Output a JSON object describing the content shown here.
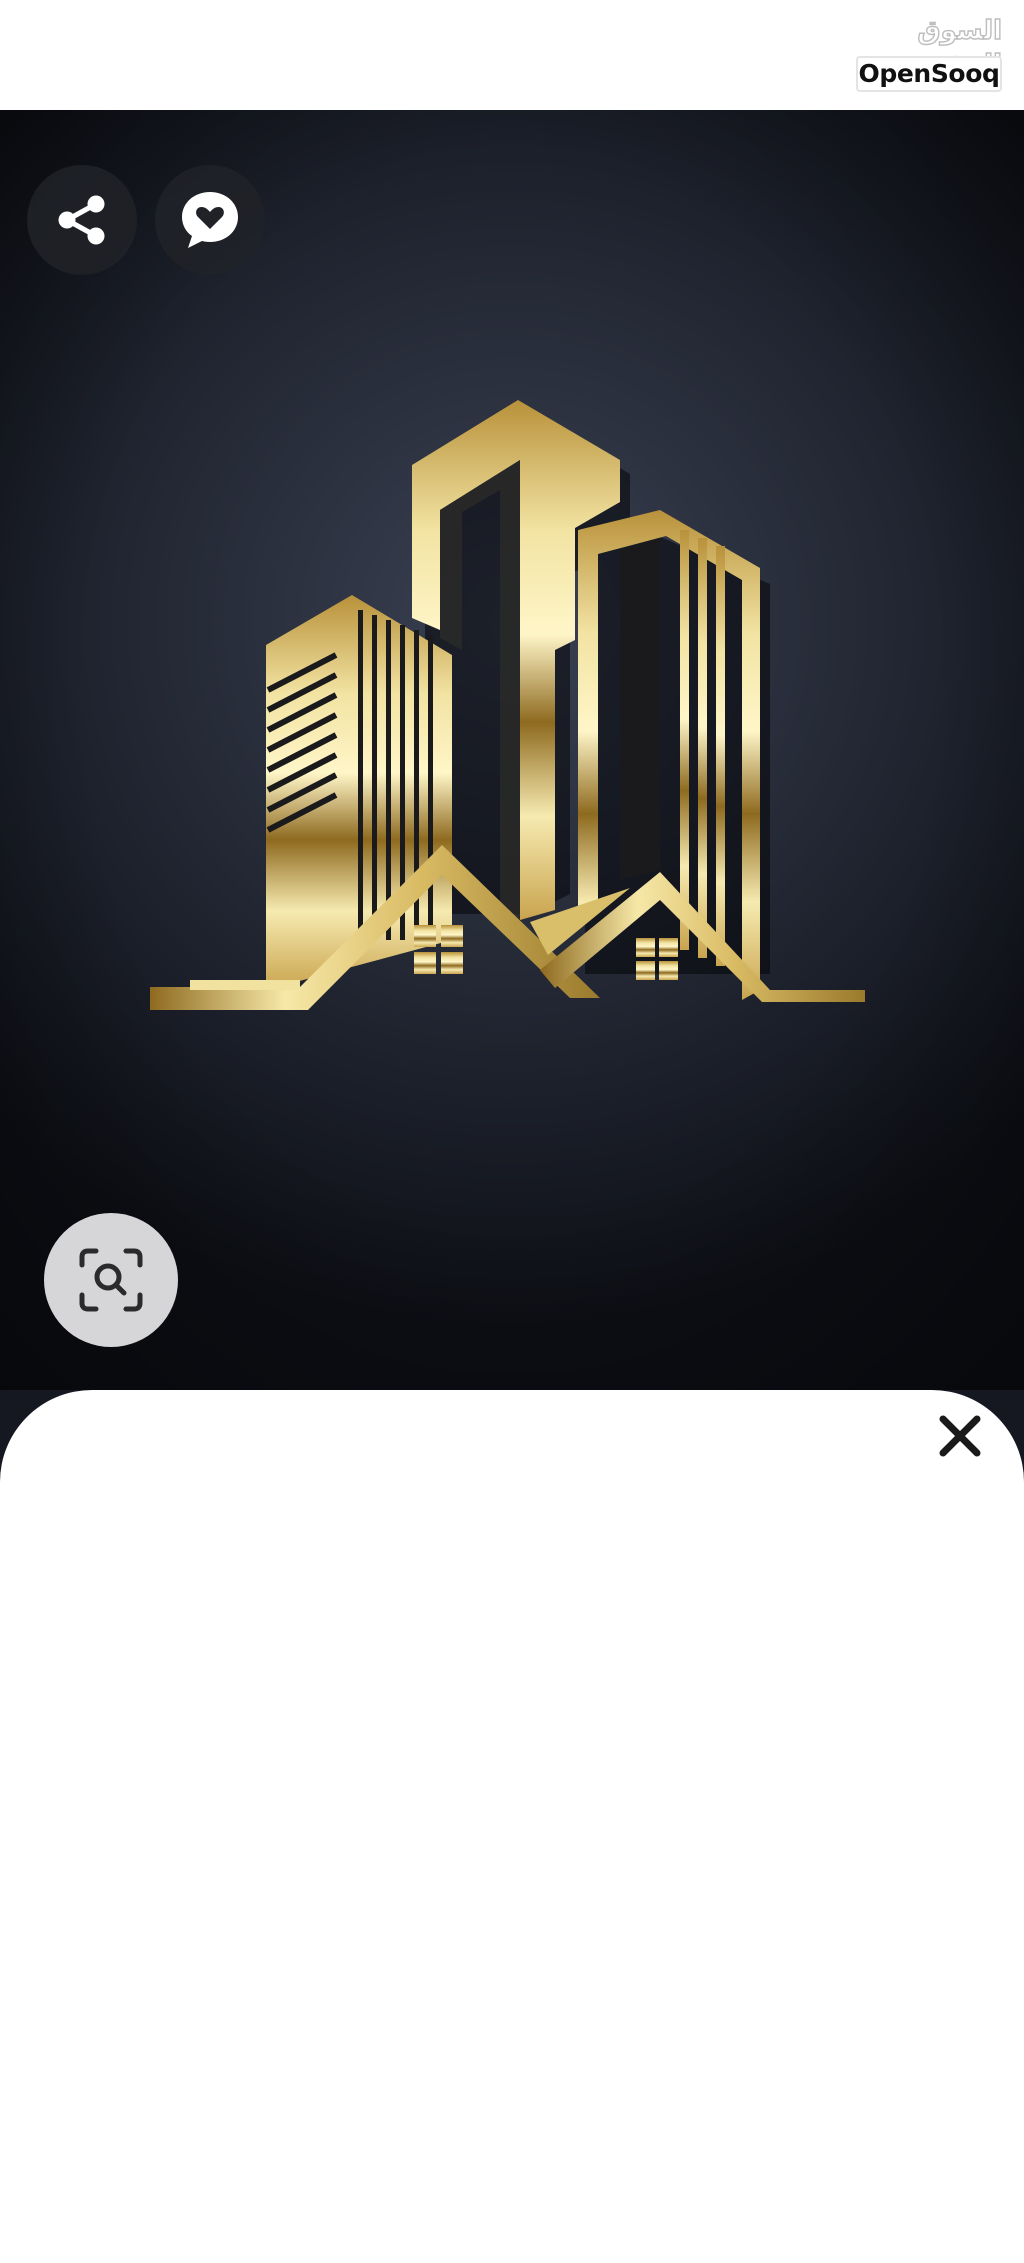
{
  "header": {
    "brand_arabic": "السوق المفتوح",
    "brand_latin": "OpenSooq"
  },
  "hero": {
    "image_description": "gold-building-logo",
    "actions": {
      "share_icon": "share-icon",
      "favorite_icon": "heart-chat-icon",
      "zoom_icon": "search-scan-icon"
    }
  },
  "sheet": {
    "close_icon": "close-icon"
  },
  "colors": {
    "background_dark": "#1b1f2a",
    "gold_light": "#f4e7a8",
    "gold_dark": "#8a6a1e",
    "sheet": "#ffffff",
    "button_dark": "#202228",
    "button_light": "#d6d6d8"
  }
}
